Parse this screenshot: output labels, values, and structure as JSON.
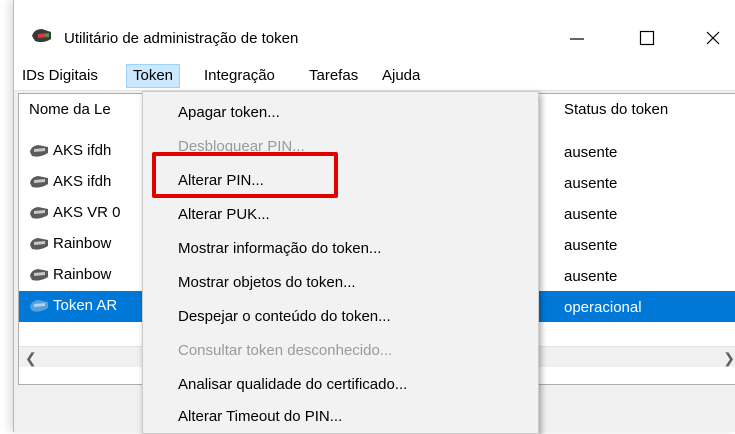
{
  "window": {
    "title": "Utilitário de administração de token",
    "controls": {
      "minimize": "—",
      "maximize": "☐",
      "close": "✕"
    }
  },
  "menubar": {
    "items": [
      "IDs Digitais",
      "Token",
      "Integração",
      "Tarefas",
      "Ajuda"
    ],
    "active": "Token"
  },
  "list": {
    "columns": {
      "name": "Nome da Le",
      "status": "Status do token"
    },
    "rows": [
      {
        "name": "AKS ifdh",
        "status": "ausente",
        "selected": false,
        "icon": "token-reader-icon"
      },
      {
        "name": "AKS ifdh",
        "status": "ausente",
        "selected": false,
        "icon": "token-reader-icon"
      },
      {
        "name": "AKS VR 0",
        "status": "ausente",
        "selected": false,
        "icon": "token-reader-icon"
      },
      {
        "name": "Rainbow",
        "status": "ausente",
        "selected": false,
        "icon": "token-reader-icon"
      },
      {
        "name": "Rainbow",
        "status": "ausente",
        "selected": false,
        "icon": "token-reader-icon"
      },
      {
        "name": "Token AR",
        "status": "operacional",
        "selected": true,
        "icon": "token-active-icon"
      }
    ]
  },
  "token_menu": {
    "items": [
      {
        "label": "Apagar token...",
        "enabled": true
      },
      {
        "label": "Desbloquear PIN...",
        "enabled": false
      },
      {
        "label": "Alterar PIN...",
        "enabled": true,
        "highlighted": true
      },
      {
        "label": "Alterar PUK...",
        "enabled": true
      },
      {
        "label": "Mostrar informação do token...",
        "enabled": true
      },
      {
        "label": "Mostrar objetos do token...",
        "enabled": true
      },
      {
        "label": "Despejar o conteúdo do token...",
        "enabled": true
      },
      {
        "label": "Consultar token desconhecido...",
        "enabled": false
      },
      {
        "label": "Analisar qualidade do certificado...",
        "enabled": true
      },
      {
        "label": "Alterar Timeout do PIN...",
        "enabled": true
      }
    ]
  },
  "colors": {
    "selection": "#0078d7",
    "menu_active": "#cce8ff",
    "annotation": "#e00000",
    "disabled_text": "#9a9a9a"
  }
}
